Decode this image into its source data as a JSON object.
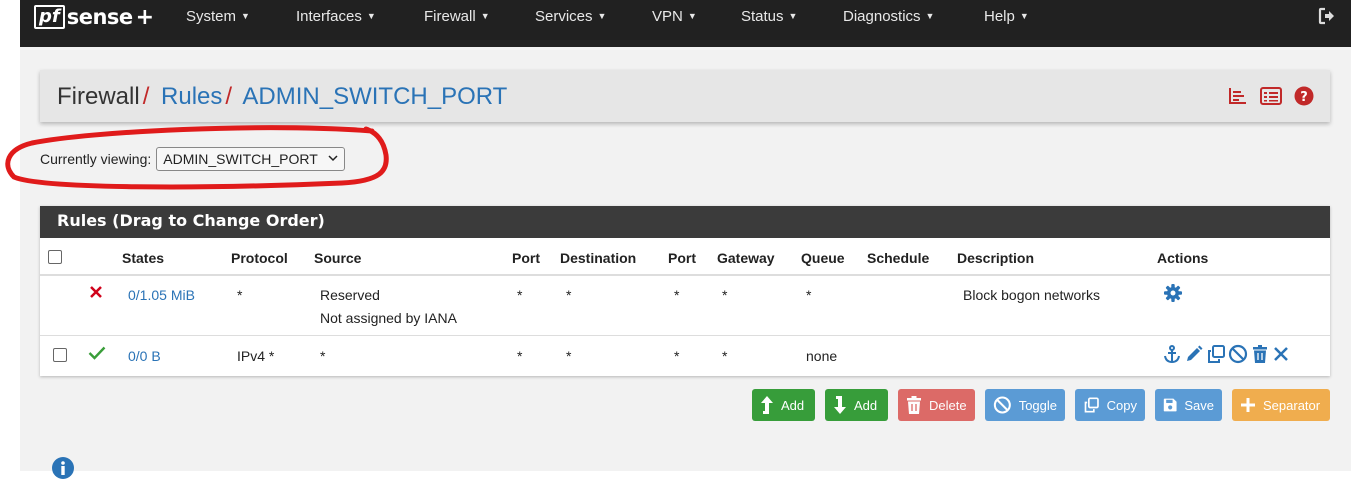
{
  "brand": {
    "name_pf": "pf",
    "name_sense": "sense",
    "name_plus": "+"
  },
  "nav": {
    "items": [
      {
        "label": "System"
      },
      {
        "label": "Interfaces"
      },
      {
        "label": "Firewall"
      },
      {
        "label": "Services"
      },
      {
        "label": "VPN"
      },
      {
        "label": "Status"
      },
      {
        "label": "Diagnostics"
      },
      {
        "label": "Help"
      }
    ]
  },
  "breadcrumb": {
    "part1": "Firewall",
    "part2": "Rules",
    "part3": "ADMIN_SWITCH_PORT",
    "sep": "/"
  },
  "viewing": {
    "label": "Currently viewing:",
    "selected": "ADMIN_SWITCH_PORT"
  },
  "rules_panel": {
    "title": "Rules (Drag to Change Order)",
    "columns": {
      "states": "States",
      "protocol": "Protocol",
      "source": "Source",
      "port1": "Port",
      "destination": "Destination",
      "port2": "Port",
      "gateway": "Gateway",
      "queue": "Queue",
      "schedule": "Schedule",
      "description": "Description",
      "actions": "Actions"
    },
    "rows": [
      {
        "status": "block",
        "states": "0/1.05 MiB",
        "protocol": "*",
        "source_line1": "Reserved",
        "source_line2": "Not assigned by IANA",
        "port1": "*",
        "destination": "*",
        "port2": "*",
        "gateway": "*",
        "queue": "*",
        "schedule": "",
        "description": "Block bogon networks"
      },
      {
        "status": "pass",
        "states": "0/0 B",
        "protocol": "IPv4 *",
        "source": "*",
        "port1": "*",
        "destination": "*",
        "port2": "*",
        "gateway": "*",
        "queue": "none",
        "schedule": "",
        "description": ""
      }
    ]
  },
  "buttons": {
    "add_top": "Add",
    "add_bottom": "Add",
    "delete": "Delete",
    "toggle": "Toggle",
    "copy": "Copy",
    "save": "Save",
    "separator": "Separator"
  },
  "colors": {
    "navbar": "#212121",
    "link": "#2a73b6",
    "accent_red": "#c12929",
    "green": "#379d3a",
    "delete": "#d9534f",
    "blue": "#5b9bd5",
    "orange": "#f0ad4e"
  },
  "icons": [
    "logout-icon",
    "stats-icon",
    "list-icon",
    "help-icon",
    "block-icon",
    "pass-icon",
    "gear-icon",
    "anchor-icon",
    "edit-icon",
    "copy-icon",
    "disable-icon",
    "trash-icon",
    "delete-x-icon",
    "info-icon"
  ]
}
